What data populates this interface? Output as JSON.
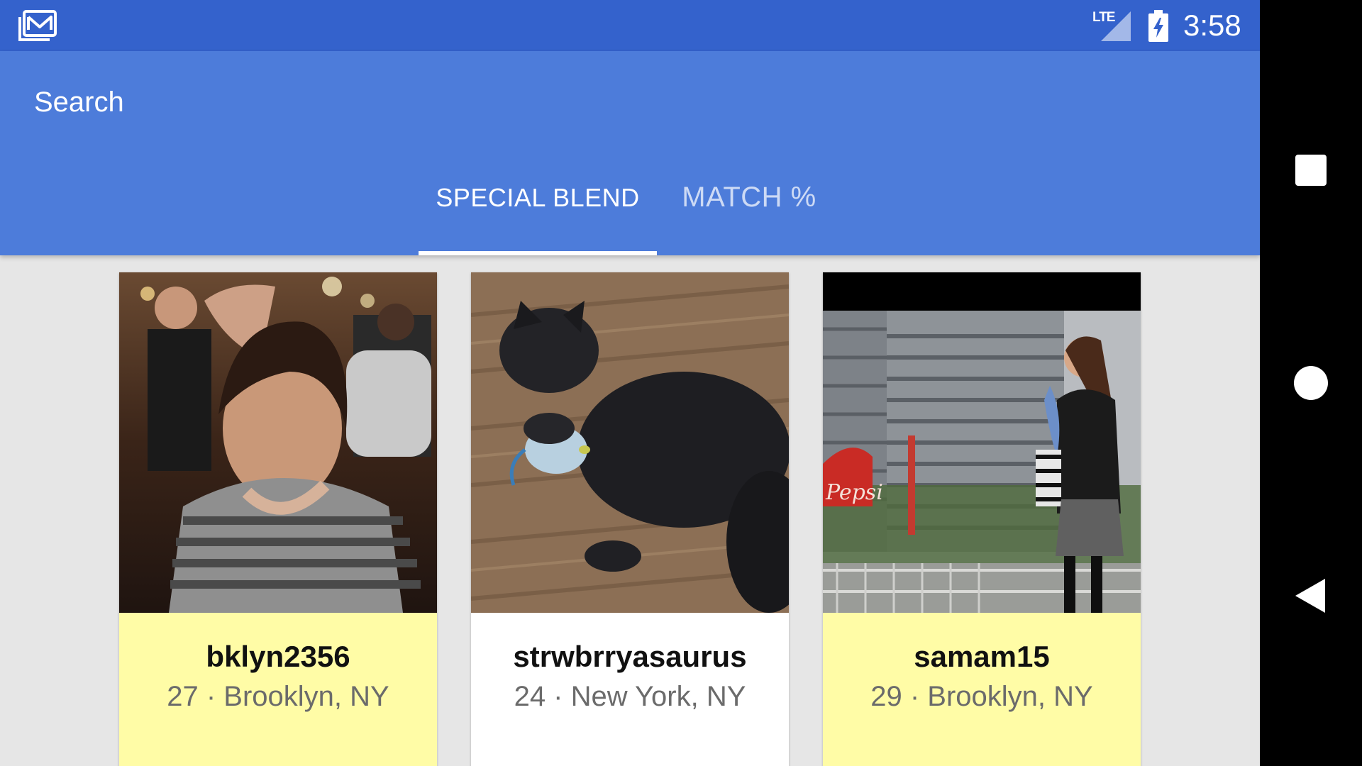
{
  "status_bar": {
    "app_icon": "envelope-card-icon",
    "network": "LTE",
    "time": "3:58",
    "colors": {
      "background": "#3462cc"
    }
  },
  "toolbar": {
    "title": "Search",
    "background": "#4d7cda",
    "tabs": [
      {
        "label": "SPECIAL BLEND",
        "selected": true
      },
      {
        "label": "MATCH %",
        "selected": false
      }
    ]
  },
  "profiles": [
    {
      "username": "bklyn2356",
      "age": "27",
      "location": "Brooklyn, NY",
      "meta": "27 · Brooklyn, NY",
      "highlighted": true,
      "photo": "woman-in-crowded-bar"
    },
    {
      "username": "strwbrryasaurus",
      "age": "24",
      "location": "New York, NY",
      "meta": "24 · New York, NY",
      "highlighted": false,
      "photo": "black-kitten-with-toy"
    },
    {
      "username": "samam15",
      "age": "29",
      "location": "Brooklyn, NY",
      "meta": "29 · Brooklyn, NY",
      "highlighted": true,
      "photo": "woman-by-waterfront-pepsi-sign"
    }
  ],
  "nav_bar": {
    "buttons": [
      "recents-square-icon",
      "home-circle-icon",
      "back-triangle-icon"
    ]
  },
  "colors": {
    "highlight": "#fffca6",
    "page_background": "#e6e6e6"
  }
}
